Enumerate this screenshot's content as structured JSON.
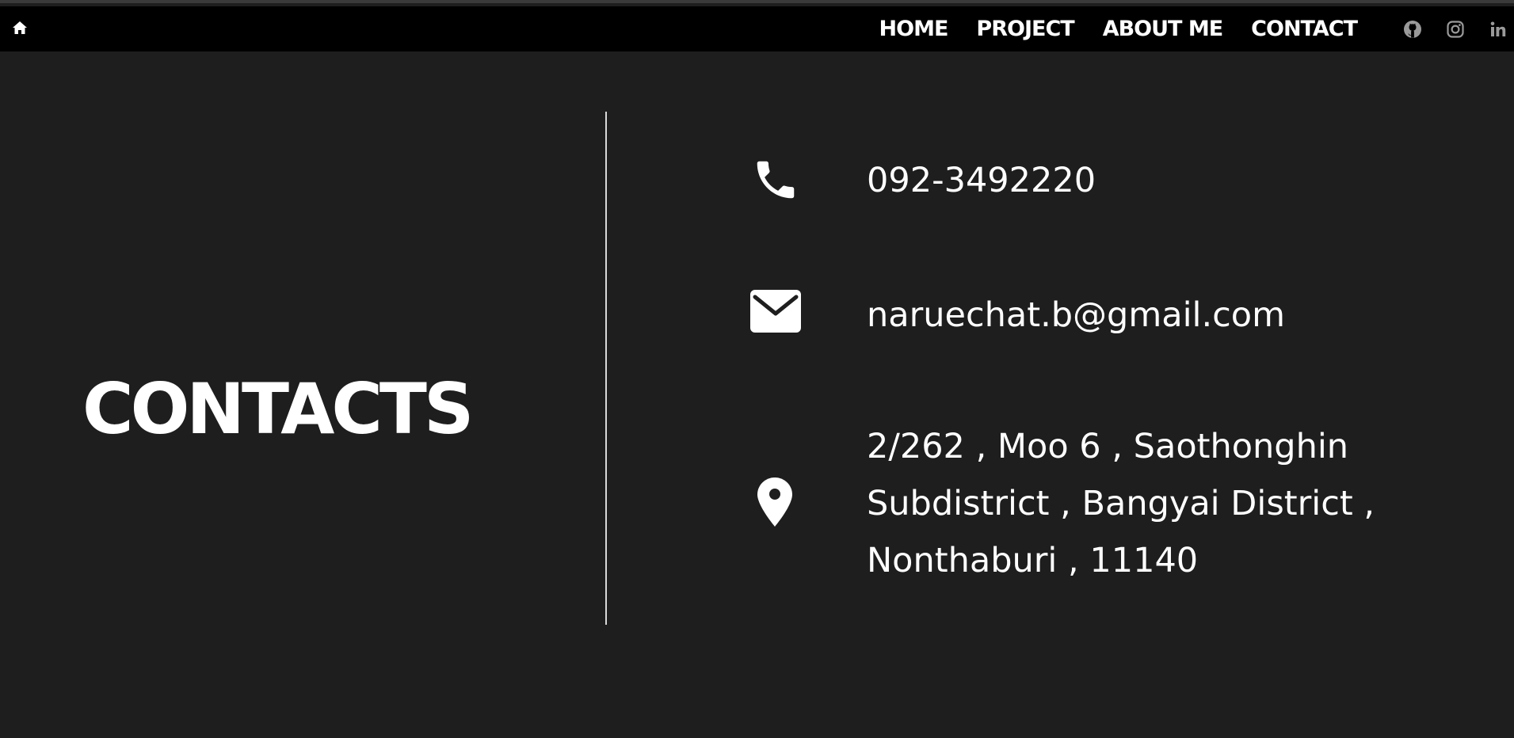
{
  "nav": {
    "home_icon": "home-icon",
    "links": [
      "HOME",
      "PROJECT",
      "ABOUT ME",
      "CONTACT"
    ],
    "social_icons": [
      "github-icon",
      "instagram-icon",
      "linkedin-icon"
    ]
  },
  "page": {
    "title": "CONTACTS"
  },
  "contacts": {
    "phone": "092-3492220",
    "email": "naruechat.b@gmail.com",
    "address_lines": [
      "2/262 , Moo 6 , Saothonghin",
      "Subdistrict , Bangyai District ,",
      "Nonthaburi , 11140"
    ]
  },
  "colors": {
    "background": "#1e1e1e",
    "navbar": "#000000",
    "text": "#ffffff",
    "divider": "#d9d9d9"
  }
}
